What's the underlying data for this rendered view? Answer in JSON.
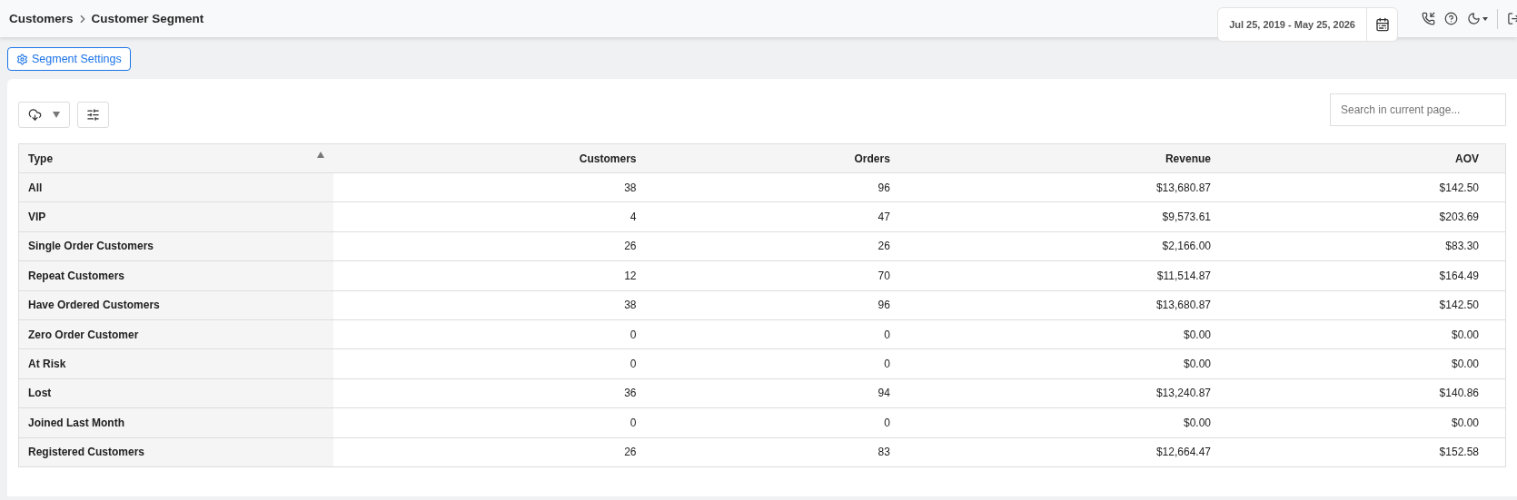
{
  "breadcrumb": [
    "Customers",
    "Customer Segment"
  ],
  "date_range": "Jul 25, 2019 - May 25, 2026",
  "segment_settings_button": "Segment Settings",
  "search": {
    "placeholder": "Search in current page..."
  },
  "table": {
    "columns": [
      {
        "label": "Type",
        "sorted": true
      },
      {
        "label": "Customers",
        "sorted": false
      },
      {
        "label": "Orders",
        "sorted": false
      },
      {
        "label": "Revenue",
        "sorted": false
      },
      {
        "label": "AOV",
        "sorted": false
      }
    ],
    "rows": [
      [
        "All",
        "38",
        "96",
        "$13,680.87",
        "$142.50"
      ],
      [
        "VIP",
        "4",
        "47",
        "$9,573.61",
        "$203.69"
      ],
      [
        "Single Order Customers",
        "26",
        "26",
        "$2,166.00",
        "$83.30"
      ],
      [
        "Repeat Customers",
        "12",
        "70",
        "$11,514.87",
        "$164.49"
      ],
      [
        "Have Ordered Customers",
        "38",
        "96",
        "$13,680.87",
        "$142.50"
      ],
      [
        "Zero Order Customer",
        "0",
        "0",
        "$0.00",
        "$0.00"
      ],
      [
        "At Risk",
        "0",
        "0",
        "$0.00",
        "$0.00"
      ],
      [
        "Lost",
        "36",
        "94",
        "$13,240.87",
        "$140.86"
      ],
      [
        "Joined Last Month",
        "0",
        "0",
        "$0.00",
        "$0.00"
      ],
      [
        "Registered Customers",
        "26",
        "83",
        "$12,664.47",
        "$152.58"
      ]
    ]
  }
}
